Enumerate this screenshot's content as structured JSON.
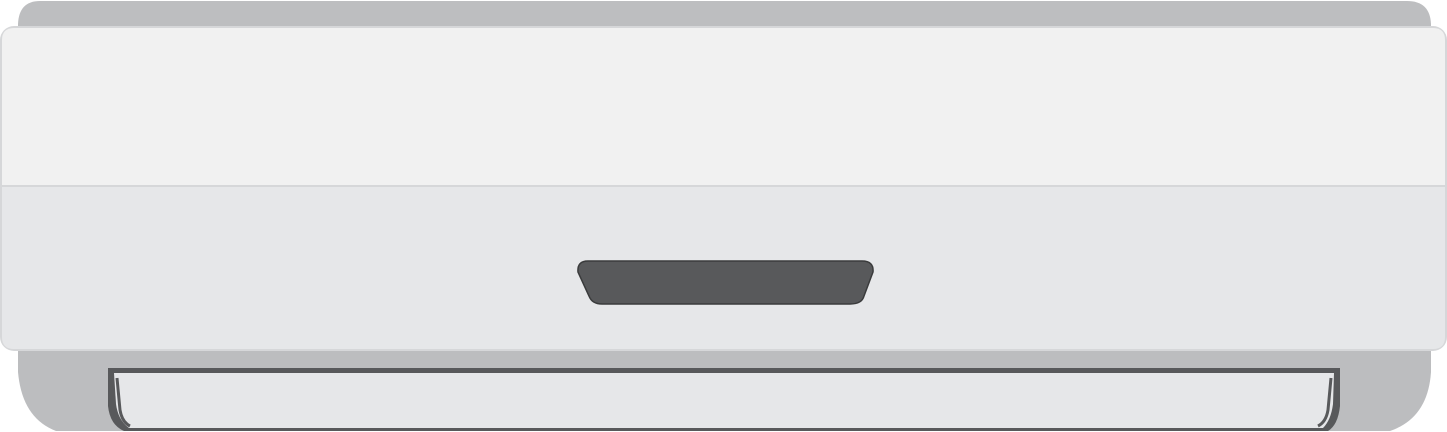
{
  "illustration": {
    "subject": "air-conditioner-indoor-unit-icon",
    "colors": {
      "background": "#ffffff",
      "top_cap": "#bdbec0",
      "upper_panel": "#f1f1f1",
      "upper_panel_edge": "#d6d7d9",
      "lower_panel": "#e6e7e9",
      "display_window": "#58595b",
      "display_window_edge": "#3a3b3c",
      "base_housing": "#bcbdbf",
      "louver_face": "#e6e7e9",
      "louver_frame": "#58595b"
    }
  }
}
